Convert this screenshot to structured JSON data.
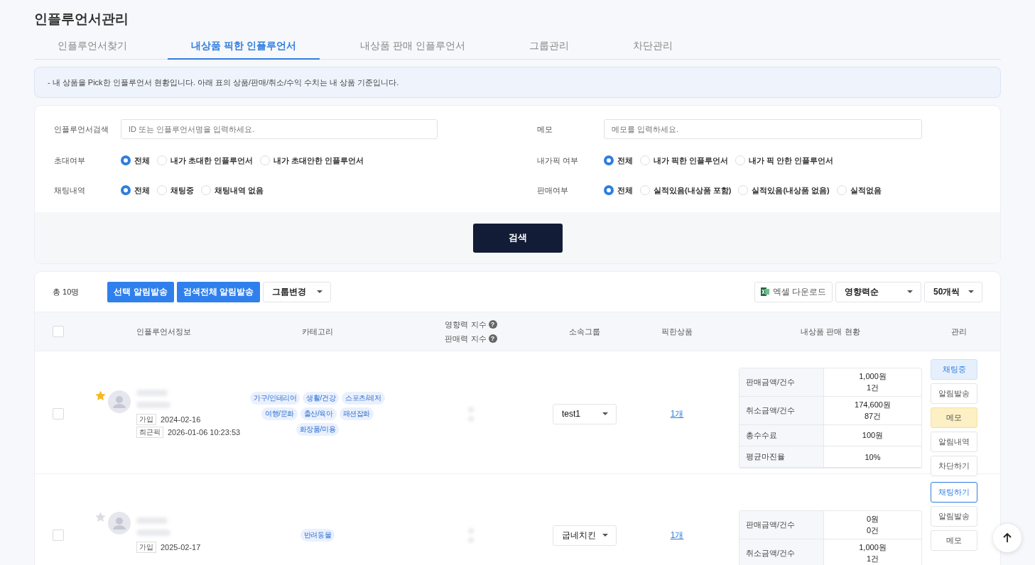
{
  "title": "인플루언서관리",
  "tabs": [
    {
      "label": "인플루언서찾기",
      "selected": false
    },
    {
      "label": "내상품 픽한 인플루언서",
      "selected": true
    },
    {
      "label": "내상품 판매 인플루언서",
      "selected": false
    },
    {
      "label": "그룹관리",
      "selected": false
    },
    {
      "label": "차단관리",
      "selected": false
    }
  ],
  "notice": "-  내 상품을 Pick한 인플루언서 현황입니다. 아래 표의 상품/판매/취소/수익 수치는 내 상품 기준입니다.",
  "filters": {
    "left": [
      {
        "kind": "text",
        "label": "인플루언서검색",
        "placeholder": "ID 또는 인플루언서명을 입력하세요."
      },
      {
        "kind": "radio",
        "label": "초대여부",
        "options": [
          {
            "label": "전체",
            "selected": true
          },
          {
            "label": "내가 초대한 인플루언서",
            "selected": false
          },
          {
            "label": "내가 초대안한 인플루언서",
            "selected": false
          }
        ]
      },
      {
        "kind": "radio",
        "label": "채팅내역",
        "options": [
          {
            "label": "전체",
            "selected": true
          },
          {
            "label": "채팅중",
            "selected": false
          },
          {
            "label": "채팅내역 없음",
            "selected": false
          }
        ]
      }
    ],
    "right": [
      {
        "kind": "text",
        "label": "메모",
        "placeholder": "메모를 입력하세요."
      },
      {
        "kind": "radio",
        "label": "내가픽 여부",
        "options": [
          {
            "label": "전체",
            "selected": true
          },
          {
            "label": "내가 픽한 인플루언서",
            "selected": false
          },
          {
            "label": "내가 픽 안한 인플루언서",
            "selected": false
          }
        ]
      },
      {
        "kind": "radio",
        "label": "판매여부",
        "options": [
          {
            "label": "전체",
            "selected": true
          },
          {
            "label": "실적있음(내상품 포함)",
            "selected": false
          },
          {
            "label": "실적있음(내상품 없음)",
            "selected": false
          },
          {
            "label": "실적없음",
            "selected": false
          }
        ]
      }
    ]
  },
  "search_button": "검색",
  "toolbar": {
    "total": "총 10명",
    "buttons": [
      "선택 알림발송",
      "검색전체 알림발송"
    ],
    "group_select": "그룹변경",
    "excel_button": "엑셀 다운로드",
    "sort_select": "영향력순",
    "page_size_select": "50개씩"
  },
  "table": {
    "select_all_checked": false,
    "help_icon": "?",
    "columns": [
      "인플루언서정보",
      "카테고리",
      "영향력 지수",
      "판매력 지수",
      "소속그룹",
      "픽한상품",
      "내상품 판매 현황",
      "관리"
    ],
    "rows": [
      {
        "checked": false,
        "starred": true,
        "join_label": "가입",
        "join_date": "2024-02-16",
        "recent_label": "최근픽",
        "recent_pick": "2026-01-06 10:23:53",
        "categories": [
          "가구/인테리어",
          "생활/건강",
          "스포츠/레저",
          "여행/문화",
          "출산/육아",
          "패션잡화",
          "화장품/미용"
        ],
        "group": "test1",
        "picked": "1개",
        "sales": [
          {
            "label": "판매금액/건수",
            "lines": [
              "1,000원",
              "1건"
            ]
          },
          {
            "label": "취소금액/건수",
            "lines": [
              "174,600원",
              "87건"
            ]
          },
          {
            "label": "총수수료",
            "lines": [
              "100원"
            ]
          },
          {
            "label": "평균마진율",
            "lines": [
              "10%"
            ]
          }
        ],
        "actions": [
          {
            "label": "채팅중",
            "kind": "chat-active"
          },
          {
            "label": "알림발송",
            "kind": "plain"
          },
          {
            "label": "메모",
            "kind": "memo-filled"
          },
          {
            "label": "알림내역",
            "kind": "plain"
          },
          {
            "label": "차단하기",
            "kind": "plain"
          }
        ]
      },
      {
        "checked": false,
        "starred": false,
        "join_label": "가입",
        "join_date": "2025-02-17",
        "categories": [
          "반려동물"
        ],
        "group": "굽네치킨",
        "picked": "1개",
        "sales": [
          {
            "label": "판매금액/건수",
            "lines": [
              "0원",
              "0건"
            ]
          },
          {
            "label": "취소금액/건수",
            "lines": [
              "1,000원",
              "1건"
            ]
          }
        ],
        "actions": [
          {
            "label": "채팅하기",
            "kind": "chat"
          },
          {
            "label": "알림발송",
            "kind": "plain"
          },
          {
            "label": "메모",
            "kind": "plain"
          }
        ]
      }
    ]
  }
}
